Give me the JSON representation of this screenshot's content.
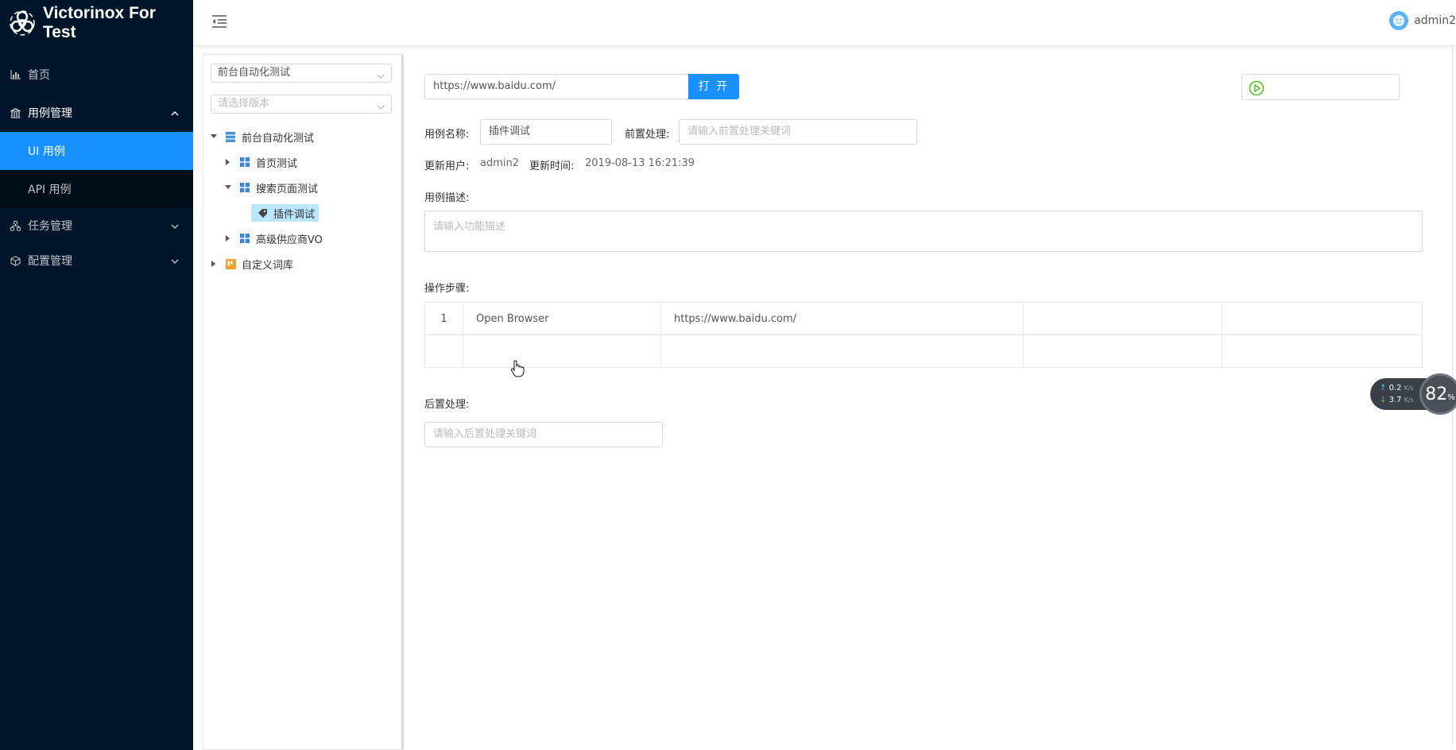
{
  "app": {
    "title": "Victorinox For Test"
  },
  "sidebar": {
    "items": [
      {
        "label": "首页",
        "icon": "chart-icon"
      },
      {
        "label": "用例管理",
        "icon": "bank-icon",
        "expanded": true,
        "children": [
          {
            "label": "UI 用例",
            "active": true
          },
          {
            "label": "API 用例"
          }
        ]
      },
      {
        "label": "任务管理",
        "icon": "apartment-icon"
      },
      {
        "label": "配置管理",
        "icon": "cube-icon"
      }
    ]
  },
  "header": {
    "username": "admin2"
  },
  "tree": {
    "project_select": "前台自动化测试",
    "version_placeholder": "请选择版本",
    "nodes": [
      {
        "label": "前台自动化测试"
      },
      {
        "label": "首页测试"
      },
      {
        "label": "搜索页面测试"
      },
      {
        "label": "插件调试"
      },
      {
        "label": "高级供应商VO"
      },
      {
        "label": "自定义词库"
      }
    ]
  },
  "main": {
    "url_value": "https://www.baidu.com/",
    "open_button": "打 开",
    "case_name_label": "用例名称:",
    "case_name_value": "插件调试",
    "preprocess_label": "前置处理:",
    "preprocess_placeholder": "请输入前置处理关键词",
    "update_user_label": "更新用户:",
    "update_user_value": "admin2",
    "update_time_label": "更新时间:",
    "update_time_value": "2019-08-13 16:21:39",
    "desc_label": "用例描述:",
    "desc_placeholder": "请输入功能描述",
    "steps_label": "操作步骤:",
    "steps": [
      {
        "index": "1",
        "keyword": "Open Browser",
        "arg1": "https://www.baidu.com/",
        "arg2": "",
        "arg3": ""
      },
      {
        "index": "",
        "keyword": "",
        "arg1": "",
        "arg2": "",
        "arg3": ""
      }
    ],
    "postprocess_label": "后置处理:",
    "postprocess_placeholder": "请输入后置处理关键词"
  },
  "net_widget": {
    "up": "0.2",
    "down": "3.7",
    "unit": "K/s",
    "percent": "82",
    "percent_sign": "%"
  },
  "colors": {
    "sidebar_bg": "#001529",
    "accent": "#1890ff",
    "run_green": "#52c41a"
  }
}
